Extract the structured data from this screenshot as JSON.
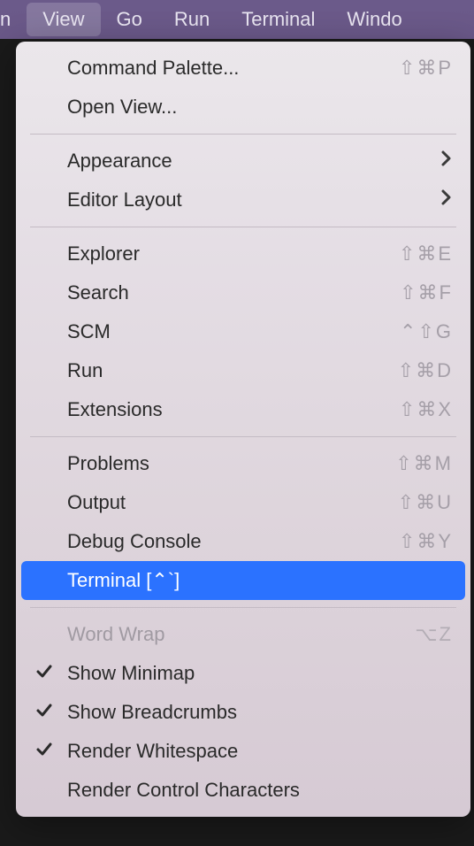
{
  "menubar": {
    "items": [
      {
        "label": "n"
      },
      {
        "label": "View"
      },
      {
        "label": "Go"
      },
      {
        "label": "Run"
      },
      {
        "label": "Terminal"
      },
      {
        "label": "Windo"
      }
    ],
    "activeIndex": 1
  },
  "dropdown": {
    "groups": [
      {
        "items": [
          {
            "label": "Command Palette...",
            "shortcut": "⇧⌘P"
          },
          {
            "label": "Open View..."
          }
        ]
      },
      {
        "items": [
          {
            "label": "Appearance",
            "submenu": true
          },
          {
            "label": "Editor Layout",
            "submenu": true
          }
        ]
      },
      {
        "items": [
          {
            "label": "Explorer",
            "shortcut": "⇧⌘E"
          },
          {
            "label": "Search",
            "shortcut": "⇧⌘F"
          },
          {
            "label": "SCM",
            "shortcut": "⌃⇧G"
          },
          {
            "label": "Run",
            "shortcut": "⇧⌘D"
          },
          {
            "label": "Extensions",
            "shortcut": "⇧⌘X"
          }
        ]
      },
      {
        "items": [
          {
            "label": "Problems",
            "shortcut": "⇧⌘M"
          },
          {
            "label": "Output",
            "shortcut": "⇧⌘U"
          },
          {
            "label": "Debug Console",
            "shortcut": "⇧⌘Y"
          },
          {
            "label": "Terminal [⌃`]",
            "highlighted": true
          }
        ]
      },
      {
        "items": [
          {
            "label": "Word Wrap",
            "shortcut": "⌥Z",
            "disabled": true
          },
          {
            "label": "Show Minimap",
            "checked": true
          },
          {
            "label": "Show Breadcrumbs",
            "checked": true
          },
          {
            "label": "Render Whitespace",
            "checked": true
          },
          {
            "label": "Render Control Characters"
          }
        ]
      }
    ]
  }
}
